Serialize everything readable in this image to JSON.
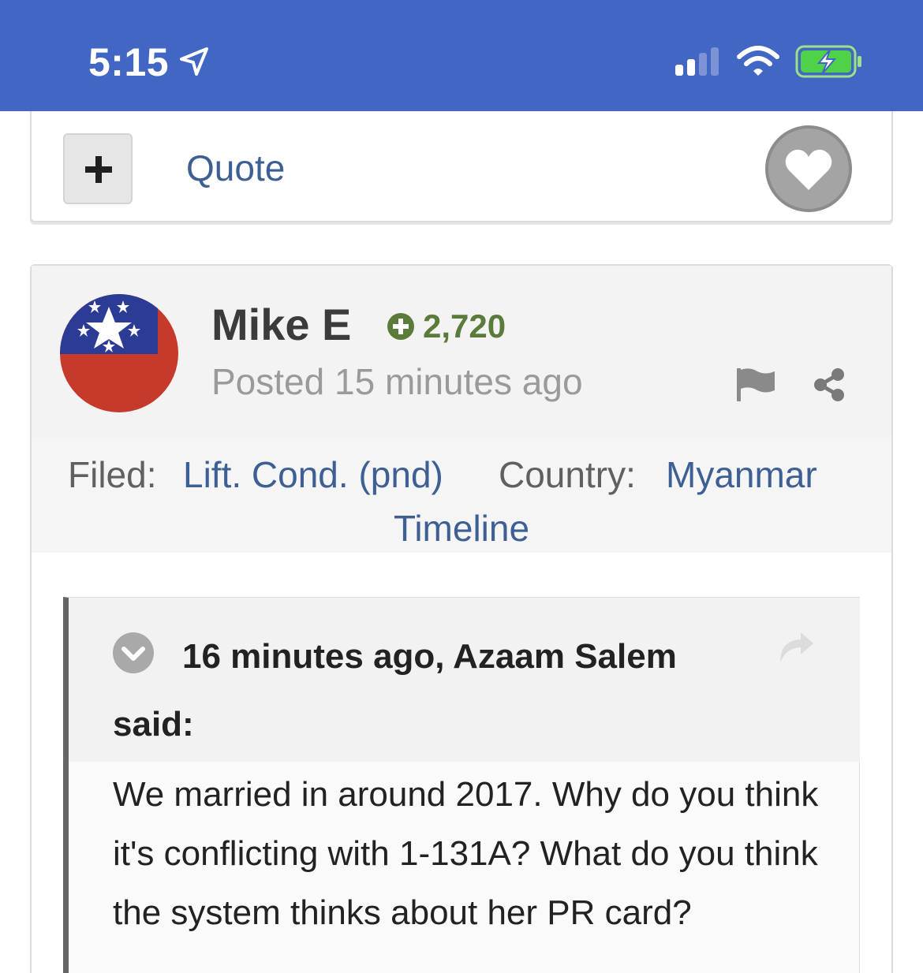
{
  "status_bar": {
    "time": "5:15",
    "icons": [
      "location-arrow-icon",
      "signal-icon",
      "wifi-icon",
      "battery-charging-icon"
    ]
  },
  "prev_post": {
    "quote_label": "Quote",
    "icons": [
      "plus-icon",
      "heart-icon"
    ]
  },
  "post": {
    "author_name": "Mike E",
    "reputation": "2,720",
    "posted": "Posted 15 minutes ago",
    "filed_label": "Filed:",
    "filed_value": "Lift. Cond. (pnd)",
    "country_label": "Country:",
    "country_value": "Myanmar",
    "timeline_label": "Timeline",
    "icons": [
      "myanmar-flag-avatar",
      "report-flag-icon",
      "share-icon"
    ]
  },
  "quote": {
    "header": "16 minutes ago, Azaam Salem said:",
    "body": "We married in around 2017. Why do you think it's conflicting with 1-131A? What do you think the system thinks about her PR card?",
    "icons": [
      "chevron-down-circle-icon",
      "reply-arrow-icon"
    ]
  },
  "colors": {
    "status_bar_bg": "#4266c4",
    "link": "#3d5f93",
    "reputation": "#5b7b3b",
    "quote_bar": "#656565"
  }
}
